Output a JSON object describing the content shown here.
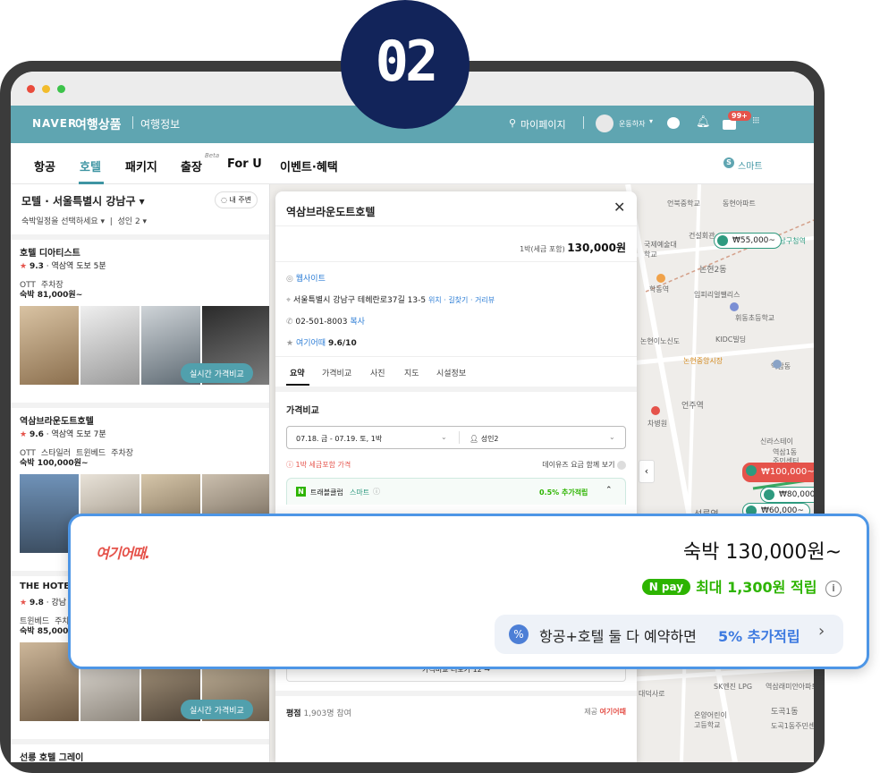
{
  "step_badge": "02",
  "colors": {
    "header": "#5fa5b1",
    "accent_green": "#2e9a7f",
    "card_border": "#4d96e6",
    "badge": "#12245a",
    "price_pin_red": "#e5534b"
  },
  "header": {
    "brand": "NAVER",
    "service": "여행상품",
    "sub": "여행정보",
    "mypage": "마이페이지",
    "user": "운동하자",
    "notif_count": "99+"
  },
  "nav": {
    "items": [
      "항공",
      "호텔",
      "패키지",
      "출장",
      "For U",
      "이벤트·혜택"
    ],
    "beta": "Beta",
    "smart": "스마트"
  },
  "left": {
    "title": "모텔 · 서울특별시 강남구",
    "nearby": "내 주변",
    "date_label": "숙박일정을 선택하세요",
    "guests": "성인 2",
    "hotels": [
      {
        "name": "호텔 디아티스트",
        "rating": "9.3",
        "distance": "역삼역 도보 5분",
        "tags": [
          "OTT",
          "주차장"
        ],
        "price": "숙박 81,000원~",
        "button": "실시간 가격비교"
      },
      {
        "name": "역삼브라운도트호텔",
        "rating": "9.6",
        "distance": "역삼역 도보 7분",
        "tags": [
          "OTT",
          "스타일러",
          "트윈베드",
          "주차장"
        ],
        "price": "숙박 100,000원~",
        "button": ""
      },
      {
        "name": "THE HOTE",
        "rating": "9.8",
        "distance": "강남",
        "tags": [
          "트윈베드",
          "주차"
        ],
        "price": "숙박 85,000",
        "button": "실시간 가격비교"
      },
      {
        "name": "선릉 호텔 그레이",
        "rating": "",
        "distance": "",
        "tags": [],
        "price": "",
        "button": ""
      }
    ]
  },
  "detail": {
    "title": "역삼브라운도트호텔",
    "price_note": "1박(세금 포함)",
    "price": "130,000원",
    "website": "웹사이트",
    "address": "서울특별시 강남구 테헤란로37길 13-5",
    "addr_links": [
      "위치",
      "길찾기",
      "거리뷰"
    ],
    "phone": "02-501-8003",
    "copy": "복사",
    "rating_src": "여기어때",
    "rating": "9.6/10",
    "tabs": [
      "요약",
      "가격비교",
      "사진",
      "지도",
      "시설정보"
    ],
    "section": "가격비교",
    "date_range": "07.18. 금 - 07.19. 토, 1박",
    "guests": "성인2",
    "tax_note": "1박 세금포함 가격",
    "daily_toggle": "데이유즈 요금 함께 보기",
    "club": "트래블클럽",
    "club_smart": "스마트",
    "club_reward": "0.5% 추가적립",
    "more_button": "가격비교 더보기 12 →",
    "review_label": "평점",
    "review_count": "1,903명 참여",
    "provided": "제공",
    "provider": "여기어때"
  },
  "card": {
    "logo": "여기어때.",
    "price": "숙박 130,000원~",
    "npay": "N pay",
    "reward": "최대 1,300원 적립",
    "promo": "항공+호텔 둘 다 예약하면",
    "promo_highlight": "5% 추가적립"
  },
  "map": {
    "labels": [
      "언북중학교",
      "동현아파트",
      "국제예술대학교",
      "건설회관",
      "강남구청역",
      "논현2동",
      "학동역",
      "임피리얼팰리스",
      "휘동초등학교",
      "논현이노신도",
      "KIDC빌딩",
      "논현중앙시장",
      "역삼동",
      "언주역",
      "차병원",
      "선릉역",
      "대덕사로",
      "도곡1동",
      "온양어린이고등학교",
      "도곡1동주민센터",
      "역삼래미안아파트",
      "SK엔진 LPG",
      "신라스테이",
      "역삼1동",
      "주민센터"
    ],
    "pins": [
      "₩55,000~",
      "₩100,000~",
      "₩80,000~",
      "₩60,000~"
    ]
  }
}
